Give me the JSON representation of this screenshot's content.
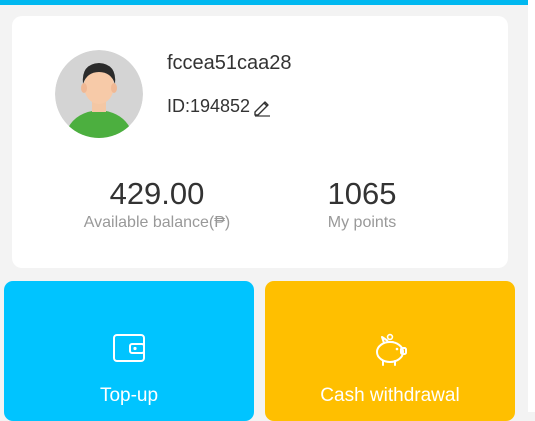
{
  "profile": {
    "username": "fccea51caa28",
    "id_text": "ID:194852",
    "avatar_icon": "user-avatar-icon",
    "edit_icon": "pencil-icon"
  },
  "stats": {
    "balance_value": "429.00",
    "balance_label": "Available balance(₱)",
    "points_value": "1065",
    "points_label": "My points"
  },
  "actions": {
    "topup_label": "Top-up",
    "topup_icon": "wallet-icon",
    "cash_label": "Cash withdrawal",
    "cash_icon": "piggy-bank-icon"
  },
  "colors": {
    "accent_blue": "#00b8f0",
    "topup_bg": "#00c4ff",
    "cash_bg": "#ffbf00",
    "avatar_bg": "#d6d6d6",
    "shirt": "#4caf3f"
  }
}
